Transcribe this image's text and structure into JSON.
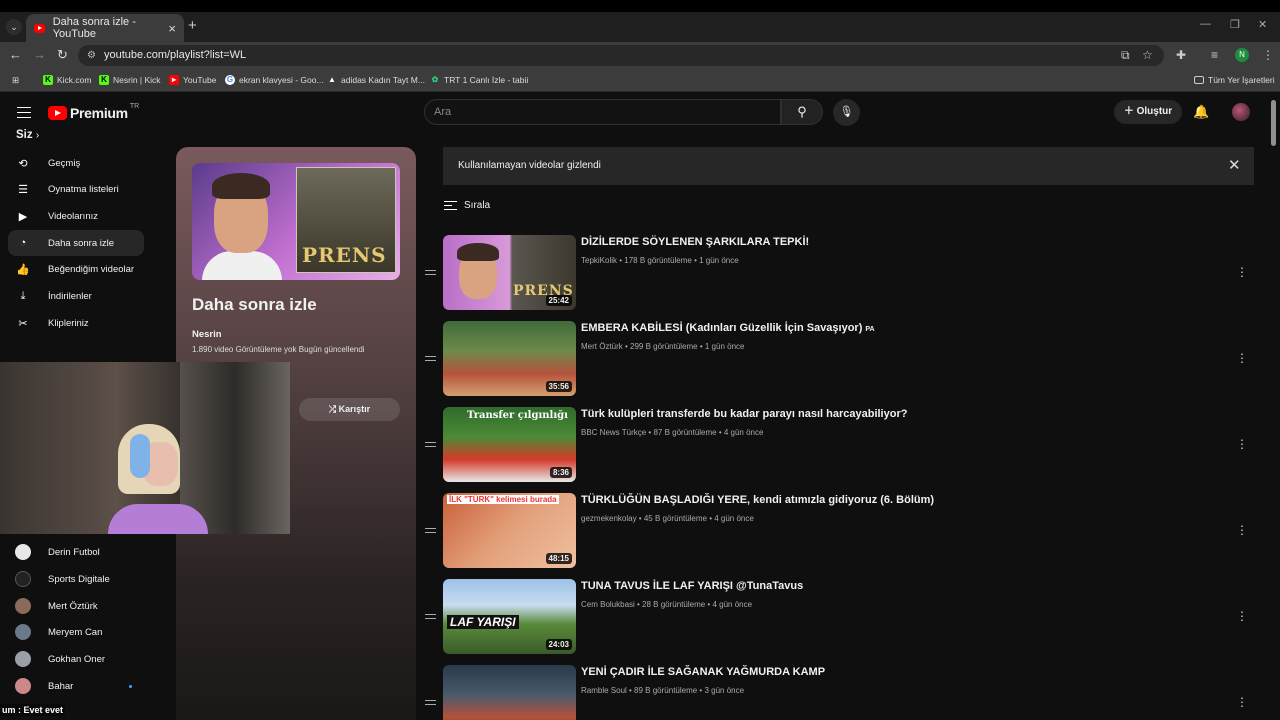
{
  "browser": {
    "tab_title": "Daha sonra izle - YouTube",
    "new_tab": "+",
    "url": "youtube.com/playlist?list=WL",
    "profile_initial": "N",
    "bookmarks": [
      {
        "label": "Kick.com",
        "icon": "kick-icon",
        "color": "#53fc18"
      },
      {
        "label": "Nesrin | Kick",
        "icon": "kick-icon",
        "color": "#53fc18"
      },
      {
        "label": "YouTube",
        "icon": "youtube-icon",
        "color": "#ff0000"
      },
      {
        "label": "ekran klavyesi - Goo...",
        "icon": "google-icon",
        "color": "#ffffff"
      },
      {
        "label": "adidas Kadın Tayt M...",
        "icon": "adidas-icon",
        "color": "#000000"
      },
      {
        "label": "TRT 1 Canlı İzle - tabii",
        "icon": "tabii-icon",
        "color": "#2bd17e"
      }
    ],
    "all_bookmarks": "Tüm Yer İşaretleri"
  },
  "header": {
    "logo": "Premium",
    "region": "TR",
    "search_placeholder": "Ara",
    "create_label": "Oluştur"
  },
  "sidebar": {
    "section_title": "Siz",
    "items": [
      {
        "label": "Geçmiş",
        "icon": "history-icon"
      },
      {
        "label": "Oynatma listeleri",
        "icon": "playlists-icon"
      },
      {
        "label": "Videolarınız",
        "icon": "your-videos-icon"
      },
      {
        "label": "Daha sonra izle",
        "icon": "watch-later-icon",
        "active": true
      },
      {
        "label": "Beğendiğim videolar",
        "icon": "like-icon"
      },
      {
        "label": "İndirilenler",
        "icon": "download-icon"
      },
      {
        "label": "Klipleriniz",
        "icon": "clips-icon"
      }
    ],
    "subscriptions": [
      {
        "label": "Derin Futbol",
        "color": "#e8e8e8"
      },
      {
        "label": "Sports Digitale",
        "color": "#222222"
      },
      {
        "label": "Mert Öztürk",
        "color": "#8a6a5a"
      },
      {
        "label": "Meryem Can",
        "color": "#6a7a8a"
      },
      {
        "label": "Gokhan Oner",
        "color": "#9aa0a6"
      },
      {
        "label": "Bahar",
        "color": "#c88"
      }
    ]
  },
  "playlist": {
    "title": "Daha sonra izle",
    "owner": "Nesrin",
    "stats": "1.890 video   Görüntüleme yok   Bugün güncellendi",
    "shuffle_label": "Karıştır",
    "thumb_text": "PRENS"
  },
  "main": {
    "banner": "Kullanılamayan videolar gizlendi",
    "sort_label": "Sırala",
    "videos": [
      {
        "title": "DİZİLERDE SÖYLENEN ŞARKILARA TEPKİ!",
        "meta": "TepkiKolik • 178 B görüntüleme • 1 gün önce",
        "duration": "25:42",
        "badge": ""
      },
      {
        "title": "EMBERA KABİLESİ (Kadınları Güzellik İçin Savaşıyor)",
        "meta": "Mert Öztürk • 299 B görüntüleme • 1 gün önce",
        "duration": "35:56",
        "badge": "PA"
      },
      {
        "title": "Türk kulüpleri transferde bu kadar parayı nasıl harcayabiliyor?",
        "meta": "BBC News Türkçe • 87 B görüntüleme • 4 gün önce",
        "duration": "8:36",
        "badge": "",
        "thumb_text": "Transfer çılgınlığı"
      },
      {
        "title": "TÜRKLÜĞÜN BAŞLADIĞI YERE, kendi atımızla gidiyoruz (6. Bölüm)",
        "meta": "gezmekenkolay • 45 B görüntüleme • 4 gün önce",
        "duration": "48:15",
        "badge": "",
        "thumb_text": "İLK \"TÜRK\" kelimesi burada"
      },
      {
        "title": "TUNA TAVUS İLE LAF YARIŞI @TunaTavus",
        "meta": "Cem Bolukbasi • 28 B görüntüleme • 4 gün önce",
        "duration": "24:03",
        "badge": "",
        "thumb_text": "LAF YARIŞI"
      },
      {
        "title": "YENİ ÇADIR İLE SAĞANAK YAĞMURDA KAMP",
        "meta": "Ramble Soul • 89 B görüntüleme • 3 gün önce",
        "duration": "",
        "badge": ""
      }
    ]
  },
  "overlay": {
    "chat_text": "um : Evet evet"
  }
}
